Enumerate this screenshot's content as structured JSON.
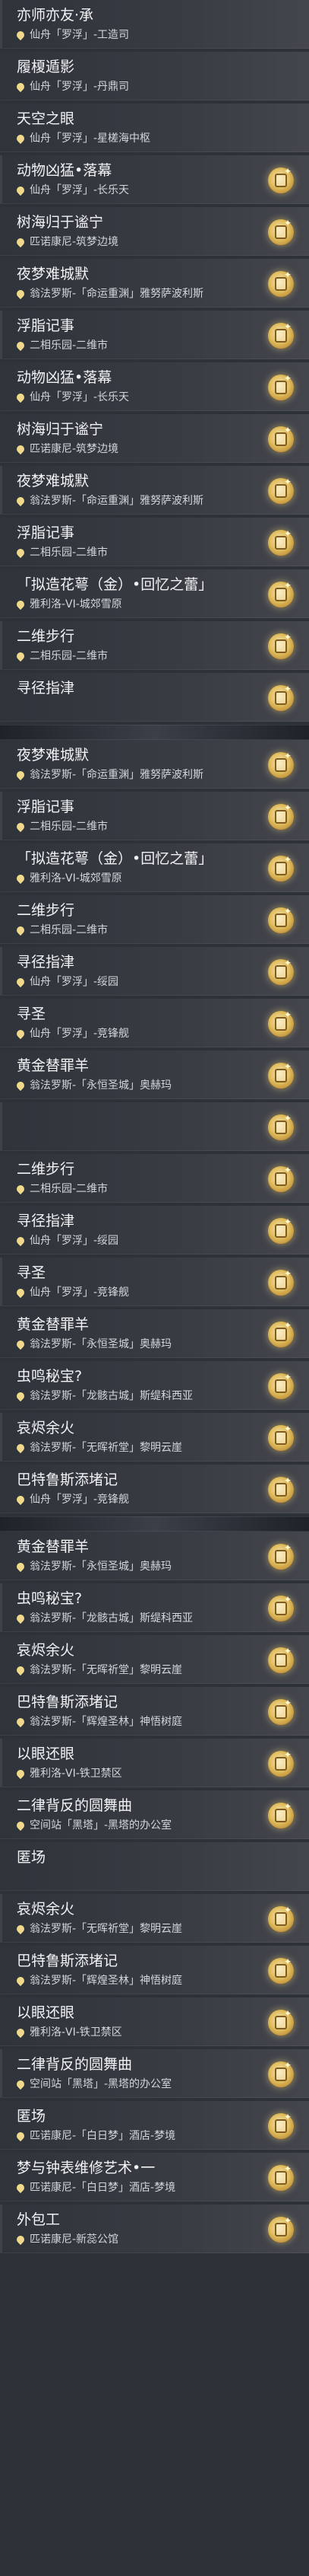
{
  "items": [
    {
      "title": "亦师亦友·承",
      "location": "仙舟「罗浮」-工造司",
      "badge": false
    },
    {
      "title": "履榎遁影",
      "location": "仙舟「罗浮」-丹鼎司",
      "badge": false
    },
    {
      "title": "天空之眼",
      "location": "仙舟「罗浮」-星槎海中枢",
      "badge": false
    },
    {
      "title": "动物凶猛•落幕",
      "location": "仙舟「罗浮」-长乐天",
      "badge": true
    },
    {
      "title": "树海归于谧宁",
      "location": "匹诺康尼-筑梦边境",
      "badge": true
    },
    {
      "title": "夜梦难城默",
      "location": "翁法罗斯-「命运重渊」雅努萨波利斯",
      "badge": true
    },
    {
      "title": "浮脂记事",
      "location": "二相乐园-二维市",
      "badge": true
    },
    {
      "title": "动物凶猛•落幕",
      "location": "仙舟「罗浮」-长乐天",
      "badge": true
    },
    {
      "title": "树海归于谧宁",
      "location": "匹诺康尼-筑梦边境",
      "badge": true
    },
    {
      "title": "夜梦难城默",
      "location": "翁法罗斯-「命运重渊」雅努萨波利斯",
      "badge": true
    },
    {
      "title": "浮脂记事",
      "location": "二相乐园-二维市",
      "badge": true
    },
    {
      "title": "「拟造花萼（金）•回忆之蕾」",
      "location": "雅利洛-VI-城郊雪原",
      "badge": true
    },
    {
      "title": "二维步行",
      "location": "二相乐园-二维市",
      "badge": true
    },
    {
      "title": "寻径指津",
      "location": "",
      "badge": true
    },
    {
      "title": "夜梦难城默",
      "location": "翁法罗斯-「命运重渊」雅努萨波利斯",
      "badge": true
    },
    {
      "title": "浮脂记事",
      "location": "二相乐园-二维市",
      "badge": true
    },
    {
      "title": "「拟造花萼（金）•回忆之蕾」",
      "location": "雅利洛-VI-城郊雪原",
      "badge": true
    },
    {
      "title": "二维步行",
      "location": "二相乐园-二维市",
      "badge": true
    },
    {
      "title": "寻径指津",
      "location": "仙舟「罗浮」-绥园",
      "badge": true
    },
    {
      "title": "寻圣",
      "location": "仙舟「罗浮」-竞锋舰",
      "badge": true
    },
    {
      "title": "黄金替罪羊",
      "location": "翁法罗斯-「永恒圣城」奥赫玛",
      "badge": true
    },
    {
      "title": "",
      "location": "",
      "badge": true
    },
    {
      "title": "二维步行",
      "location": "二相乐园-二维市",
      "badge": true
    },
    {
      "title": "寻径指津",
      "location": "仙舟「罗浮」-绥园",
      "badge": true
    },
    {
      "title": "寻圣",
      "location": "仙舟「罗浮」-竞锋舰",
      "badge": true
    },
    {
      "title": "黄金替罪羊",
      "location": "翁法罗斯-「永恒圣城」奥赫玛",
      "badge": true
    },
    {
      "title": "虫鸣秘宝?",
      "location": "翁法罗斯-「龙骸古城」斯缇科西亚",
      "badge": true
    },
    {
      "title": "哀烬余火",
      "location": "翁法罗斯-「无晖祈堂」黎明云崖",
      "badge": true
    },
    {
      "title": "巴特鲁斯添堵记",
      "location": "仙舟「罗浮」-竞锋舰",
      "badge": true
    },
    {
      "title": "黄金替罪羊",
      "location": "翁法罗斯-「永恒圣城」奥赫玛",
      "badge": true
    },
    {
      "title": "虫鸣秘宝?",
      "location": "翁法罗斯-「龙骸古城」斯缇科西亚",
      "badge": true
    },
    {
      "title": "哀烬余火",
      "location": "翁法罗斯-「无晖祈堂」黎明云崖",
      "badge": true
    },
    {
      "title": "巴特鲁斯添堵记",
      "location": "翁法罗斯-「辉煌圣林」神悟树庭",
      "badge": true
    },
    {
      "title": "以眼还眼",
      "location": "雅利洛-VI-铁卫禁区",
      "badge": true
    },
    {
      "title": "二律背反的圆舞曲",
      "location": "空间站「黑塔」-黑塔的办公室",
      "badge": true
    },
    {
      "title": "匿场",
      "location": "",
      "badge": false
    },
    {
      "title": "哀烬余火",
      "location": "翁法罗斯-「无晖祈堂」黎明云崖",
      "badge": true
    },
    {
      "title": "巴特鲁斯添堵记",
      "location": "翁法罗斯-「辉煌圣林」神悟树庭",
      "badge": true
    },
    {
      "title": "以眼还眼",
      "location": "雅利洛-VI-铁卫禁区",
      "badge": true
    },
    {
      "title": "二律背反的圆舞曲",
      "location": "空间站「黑塔」-黑塔的办公室",
      "badge": true
    },
    {
      "title": "匿场",
      "location": "匹诺康尼-「白日梦」酒店-梦境",
      "badge": true
    },
    {
      "title": "梦与钟表维修艺术•一",
      "location": "匹诺康尼-「白日梦」酒店-梦境",
      "badge": true
    },
    {
      "title": "外包工",
      "location": "匹诺康尼-新蕊公馆",
      "badge": true
    }
  ]
}
